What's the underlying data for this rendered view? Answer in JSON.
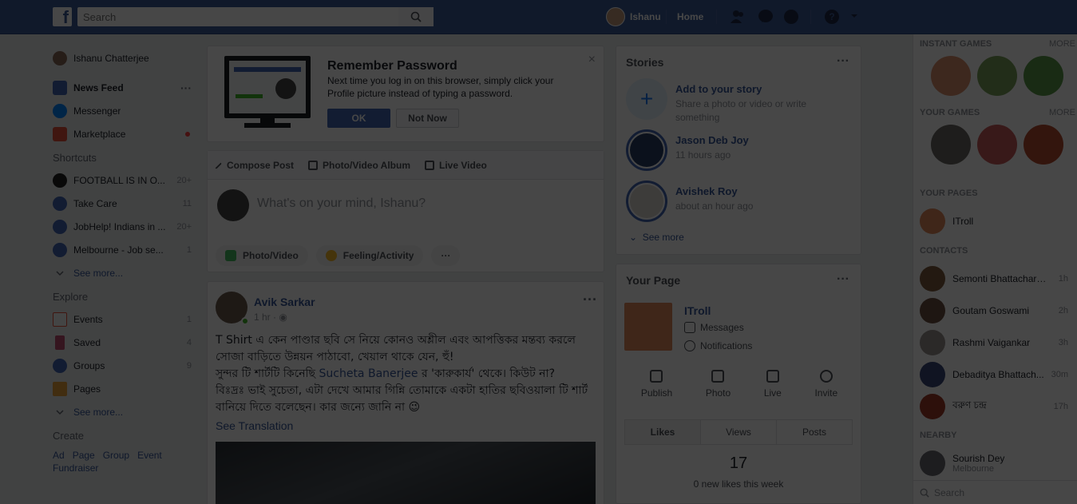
{
  "topbar": {
    "logo": "f",
    "search_placeholder": "Search",
    "user_name": "Ishanu",
    "home_label": "Home"
  },
  "leftnav": {
    "profile_name": "Ishanu Chatterjee",
    "main": [
      {
        "label": "News Feed",
        "more": "···"
      },
      {
        "label": "Messenger"
      },
      {
        "label": "Marketplace"
      }
    ],
    "shortcuts_header": "Shortcuts",
    "shortcuts": [
      {
        "label": "FOOTBALL IS IN O...",
        "count": "20+"
      },
      {
        "label": "Take Care",
        "count": "11"
      },
      {
        "label": "JobHelp! Indians in ...",
        "count": "20+"
      },
      {
        "label": "Melbourne - Job se...",
        "count": "1"
      }
    ],
    "see_more": "See more...",
    "explore_header": "Explore",
    "explore": [
      {
        "label": "Events",
        "count": "1"
      },
      {
        "label": "Saved",
        "count": "4"
      },
      {
        "label": "Groups",
        "count": "9"
      },
      {
        "label": "Pages",
        "count": ""
      }
    ],
    "create_header": "Create",
    "create_links": [
      "Ad",
      "Page",
      "Group",
      "Event",
      "Fundraiser"
    ]
  },
  "remember_password": {
    "title": "Remember Password",
    "body": "Next time you log in on this browser, simply click your Profile picture instead of typing a password.",
    "ok": "OK",
    "not_now": "Not Now",
    "close": "×"
  },
  "composer": {
    "tabs": [
      "Compose Post",
      "Photo/Video Album",
      "Live Video"
    ],
    "placeholder": "What's on your mind, Ishanu?",
    "actions": [
      "Photo/Video",
      "Feeling/Activity",
      "···"
    ]
  },
  "post": {
    "author": "Avik Sarkar",
    "time": "1 hr · ◉",
    "more": "···",
    "line1": "T Shirt এ কেন পাণ্ডার ছবি সে নিয়ে কোনও অশ্লীল এবং আপত্তিকর মন্তব্য করলে সোজা বাড়িতে উন্নয়ন পাঠাবো, খেয়াল থাকে যেন, হুঁ!",
    "line2_pre": "সুন্দর টি শার্টটি কিনেছি ",
    "line2_link": "Sucheta Banerjee",
    "line2_post": " র 'কারুকার্য' থেকে। কিউট না?",
    "line3": "বিঃদ্রঃ ভাই সুচেতা, এটা দেখে আমার গিন্নি তোমাকে একটা হাতির ছবিওয়ালা টি শার্ট বানিয়ে দিতে বলেছেন। কার জন্যে জানি না 😉",
    "see_translation": "See Translation"
  },
  "stories": {
    "title": "Stories",
    "more": "···",
    "add_title": "Add to your story",
    "add_sub": "Share a photo or video or write something",
    "items": [
      {
        "name": "Jason Deb Joy",
        "time": "11 hours ago"
      },
      {
        "name": "Avishek Roy",
        "time": "about an hour ago"
      }
    ],
    "see_more": "See more"
  },
  "your_page": {
    "title": "Your Page",
    "more": "···",
    "name": "ITroll",
    "messages": "Messages",
    "notifications": "Notifications",
    "actions": [
      "Publish",
      "Photo",
      "Live",
      "Invite"
    ],
    "tabs": [
      "Likes",
      "Views",
      "Posts"
    ],
    "stat": "17",
    "stat_sub": "0 new likes this week"
  },
  "chat_sidebar": {
    "instant_games": "Instant Games",
    "instant_games_more": "MORE",
    "your_games": "Your Games",
    "your_games_more": "MORE",
    "your_pages": "Your Pages",
    "page_name": "ITroll",
    "contacts_header": "Contacts",
    "contacts": [
      {
        "name": "Semonti Bhattacharyya",
        "time": "1h"
      },
      {
        "name": "Goutam Goswami",
        "time": "2h"
      },
      {
        "name": "Rashmi Vaigankar",
        "time": "3h"
      },
      {
        "name": "Debaditya Bhattach...",
        "time": "30m"
      },
      {
        "name": "বরুণ চন্দ্র",
        "time": "17h"
      }
    ],
    "nearby_header": "Nearby",
    "nearby_name": "Sourish Dey",
    "nearby_sub": "Melbourne",
    "search_placeholder": "Search"
  }
}
